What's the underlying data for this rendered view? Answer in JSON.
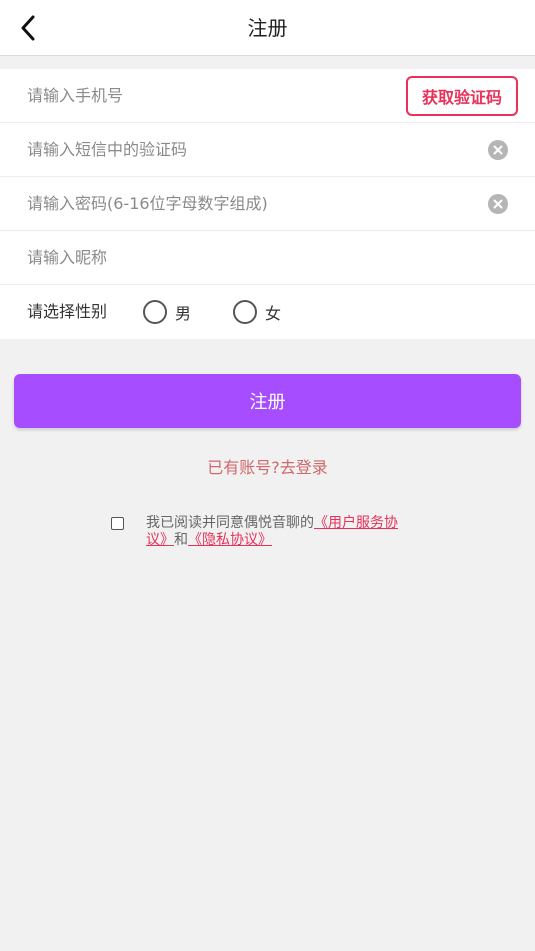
{
  "header": {
    "title": "注册",
    "back_icon": "chevron-left-icon"
  },
  "form": {
    "phone": {
      "placeholder": "请输入手机号",
      "value": ""
    },
    "get_code_label": "获取验证码",
    "sms_code": {
      "placeholder": "请输入短信中的验证码",
      "value": ""
    },
    "password": {
      "placeholder": "请输入密码(6-16位字母数字组成)",
      "value": ""
    },
    "nickname": {
      "placeholder": "请输入昵称",
      "value": ""
    },
    "gender": {
      "label": "请选择性别",
      "options": [
        "男",
        "女"
      ],
      "selected": null
    }
  },
  "actions": {
    "submit_label": "注册",
    "login_link": "已有账号?去登录"
  },
  "agreement": {
    "checked": false,
    "prefix": "我已阅读并同意偶悦音聊的",
    "user_agreement": "《用户服务协议》",
    "connector": "和",
    "privacy_agreement": "《隐私协议》"
  },
  "colors": {
    "accent_purple": "#a64dff",
    "accent_red": "#e8325a",
    "link_red": "#d0686c",
    "background": "#f1f1f1"
  }
}
